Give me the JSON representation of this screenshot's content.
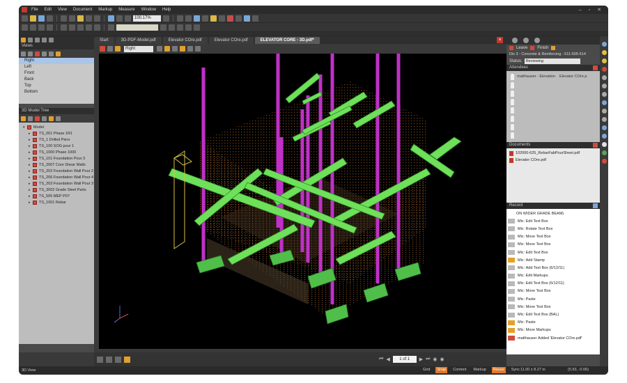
{
  "app": {
    "menus": [
      "File",
      "Edit",
      "View",
      "Document",
      "Markup",
      "Measure",
      "Window",
      "Help"
    ],
    "zoom": "100.17%",
    "status_left": "3D View",
    "status_toggles": [
      {
        "label": "Grid",
        "on": false
      },
      {
        "label": "Snap",
        "on": true
      },
      {
        "label": "Content",
        "on": false
      },
      {
        "label": "Markup",
        "on": false
      },
      {
        "label": "Reuse",
        "on": true
      },
      {
        "label": "Sync",
        "on": false
      }
    ],
    "dimensions": "11.00 x 8.27 in",
    "coordinates": "(5.93, -0.06)"
  },
  "views": {
    "title": "Views",
    "items": [
      "Right",
      "Left",
      "Front",
      "Back",
      "Top",
      "Bottom"
    ],
    "selected": "Right"
  },
  "model_tree": {
    "title": "3D Model Tree",
    "root": "Model",
    "items": [
      "TS_001 Phase 1R1",
      "TS_1 Drilled Piers",
      "TS_100 SOG pour 1",
      "TS_1000 Phase 1000",
      "TS_101 Foundation Pour 3",
      "TS_2007 Core Shear Walls",
      "TS_202 Foundation Wall Pour 2",
      "TS_206 Foundation Wall Pour 4",
      "TS_203 Foundation Wall Pour 3",
      "TS_3002 Grade Steel Parts",
      "TS_505 MEP P07",
      "TS_1001 Rebar"
    ]
  },
  "tabs": {
    "items": [
      "Start",
      "3D-PDF-Model.pdf",
      "Elevator COre.pdf",
      "Elevator COre.pdf",
      "ELEVATOR CORE - 3D.pdf*"
    ],
    "active_index": 4
  },
  "viewbar": {
    "view_select": "Right"
  },
  "session": {
    "leave": "Leave",
    "finish": "Finish",
    "name": "Div 3 - Concrete & Reinforcing - 611-505-614",
    "status_label": "Status:",
    "status_value": "Reviewing",
    "attendees_title": "Attendees",
    "attendees": [
      "matthauser - Elevation",
      "Elevator COre.p"
    ],
    "documents_title": "Documents",
    "documents": [
      "102000-625_RebarFabPourSheet.pdf",
      "Elevator COre.pdf"
    ],
    "record_title": "Record",
    "record_header": "ON WIDER GRADE BEAM)",
    "records": [
      {
        "who": "Mic:",
        "action": "Edit Text Box",
        "icon": "text"
      },
      {
        "who": "Mic:",
        "action": "Rotate Text Box",
        "icon": "text"
      },
      {
        "who": "Mic:",
        "action": "Move Text Box",
        "icon": "text"
      },
      {
        "who": "Mic:",
        "action": "Move Text Box",
        "icon": "text"
      },
      {
        "who": "Mic:",
        "action": "Edit Text Box",
        "icon": "text"
      },
      {
        "who": "Mic:",
        "action": "Add Stamp",
        "icon": "stamp"
      },
      {
        "who": "Mic:",
        "action": "Add Text Box (6/12/11)",
        "icon": "text"
      },
      {
        "who": "Mic:",
        "action": "Edit Markups",
        "icon": "text"
      },
      {
        "who": "Mic:",
        "action": "Edit Text Box (6/12/11)",
        "icon": "text"
      },
      {
        "who": "Mic:",
        "action": "Move Text Box",
        "icon": "text"
      },
      {
        "who": "Mic:",
        "action": "Paste",
        "icon": "text"
      },
      {
        "who": "Mic:",
        "action": "Move Text Box",
        "icon": "text"
      },
      {
        "who": "Mic:",
        "action": "Edit Text Box (BAL)",
        "icon": "text"
      },
      {
        "who": "Mic:",
        "action": "Paste",
        "icon": "stamp"
      },
      {
        "who": "Mic:",
        "action": "Move Markups",
        "icon": "stamp"
      },
      {
        "who": "matthauser",
        "action": "Added 'Elevator COre.pdf'",
        "icon": "crown"
      }
    ]
  },
  "pager": {
    "page": "1 of 1"
  }
}
